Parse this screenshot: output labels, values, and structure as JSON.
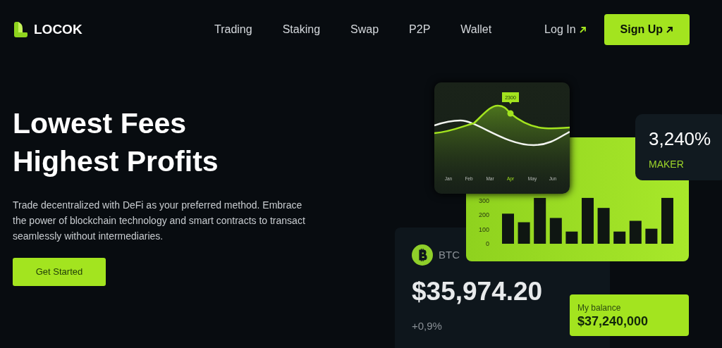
{
  "brand": {
    "name": "LOCOK"
  },
  "nav": {
    "links": [
      {
        "label": "Trading"
      },
      {
        "label": "Staking"
      },
      {
        "label": "Swap"
      },
      {
        "label": "P2P"
      },
      {
        "label": "Wallet"
      }
    ],
    "login": "Log In",
    "signup": "Sign Up"
  },
  "hero": {
    "title_lines": [
      "Lowest Fees",
      "Highest Profits"
    ],
    "description": "Trade decentralized with DeFi as your preferred method. Embrace the power of blockchain technology and smart contracts to transact seamlessly without intermediaries.",
    "cta": "Get Started"
  },
  "line_chart": {
    "tooltip": "2300",
    "months": [
      {
        "label": "Jan",
        "selected": false
      },
      {
        "label": "Feb",
        "selected": false
      },
      {
        "label": "Mar",
        "selected": false
      },
      {
        "label": "Apr",
        "selected": true
      },
      {
        "label": "May",
        "selected": false
      },
      {
        "label": "Jun",
        "selected": false
      }
    ]
  },
  "bar_card": {
    "chart_data": {
      "type": "bar",
      "categories": [
        null,
        null,
        null,
        null,
        null,
        null,
        null,
        null,
        null,
        null,
        null
      ],
      "series": [
        {
          "color": "#0f1612",
          "values": [
            210,
            150,
            320,
            180,
            85,
            320,
            250,
            85,
            160,
            105,
            320
          ]
        }
      ],
      "ylim": [
        0,
        340
      ],
      "yticks": [
        {
          "value": 0,
          "label": "0"
        },
        {
          "value": 100,
          "label": "100"
        },
        {
          "value": 200,
          "label": "200"
        },
        {
          "value": 300,
          "label": "300"
        }
      ]
    }
  },
  "maker_card": {
    "value": "3,240%",
    "label": "MAKER"
  },
  "btc_card": {
    "symbol": "BTC",
    "price": "$35,974.20",
    "change": "+0,9%"
  },
  "balance_card": {
    "label": "My balance",
    "value": "$37,240,000"
  }
}
